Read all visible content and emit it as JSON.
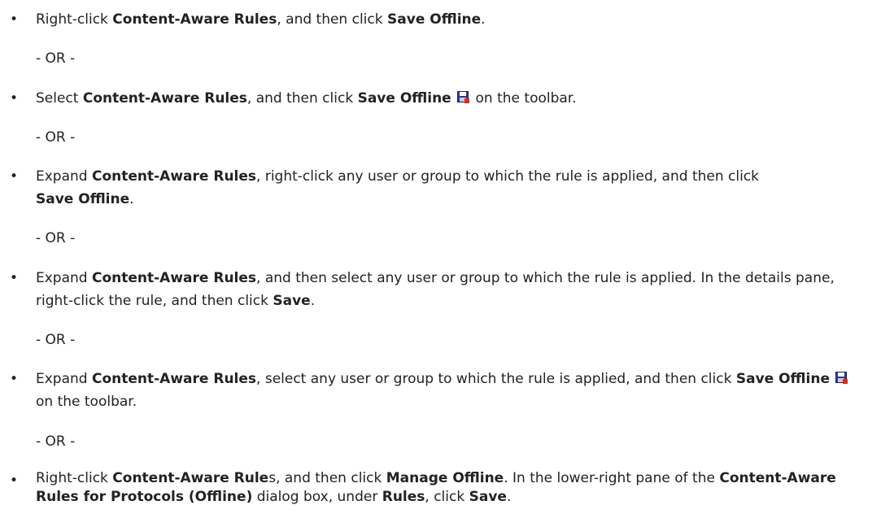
{
  "separator": "- OR -",
  "items": [
    {
      "t": [
        "Right-click ",
        "Content-Aware Rules",
        ", and then click ",
        "Save Offline",
        "."
      ]
    },
    {
      "t": [
        "Select ",
        "Content-Aware Rules",
        ", and then click ",
        "Save Offline",
        " on the toolbar."
      ],
      "icon": "save-offline-icon"
    },
    {
      "t": [
        "Expand ",
        "Content-Aware Rules",
        ", right-click any user or group to which the rule is applied, and then click ",
        "Save Offline",
        "."
      ]
    },
    {
      "t": [
        "Expand ",
        "Content-Aware Rules",
        ", and then select any user or group to which the rule is applied. In the details pane, right-click the rule, and then click ",
        "Save",
        "."
      ]
    },
    {
      "t": [
        "Expand ",
        "Content-Aware Rules",
        ", select any user or group to which the rule is applied, and then click ",
        "Save Offline",
        " on the toolbar."
      ],
      "icon": "save-offline-icon"
    },
    {
      "t": [
        "Right-click ",
        "Content-Aware Rule",
        "s, and then click ",
        "Manage Offline",
        ". In the lower-right pane of the ",
        "Content-Aware Rules for Protocols (Offline)",
        " dialog box, under ",
        "Rules",
        ", click ",
        "Save",
        "."
      ]
    }
  ]
}
